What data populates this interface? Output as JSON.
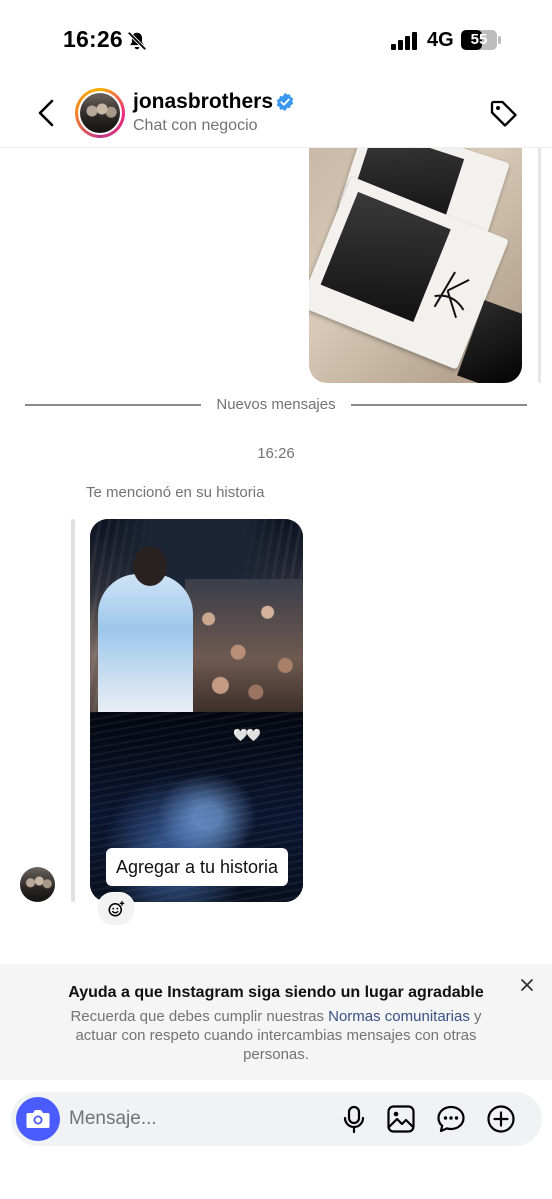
{
  "status_bar": {
    "time": "16:26",
    "network": "4G",
    "battery": "55"
  },
  "header": {
    "username": "jonasbrothers",
    "subtitle": "Chat con negocio",
    "verified": true
  },
  "conversation": {
    "divider_label": "Nuevos mensajes",
    "timestamp": "16:26",
    "mention_text": "Te mencionó en su historia",
    "story_button": "Agregar a tu historia",
    "story_hearts": "🤍🤍"
  },
  "notice": {
    "title": "Ayuda a que Instagram siga siendo un lugar agradable",
    "body_before": "Recuerda que debes cumplir nuestras ",
    "link": "Normas comunitarias",
    "body_after": " y actuar con respeto cuando intercambias mensajes con otras personas."
  },
  "composer": {
    "placeholder": "Mensaje..."
  },
  "colors": {
    "accent": "#4a5bff",
    "verified": "#3897f0",
    "link": "#385185",
    "muted_text": "#737373"
  },
  "icons": [
    "bell-slash-icon",
    "signal-icon",
    "battery-icon",
    "back-icon",
    "verified-icon",
    "tag-icon",
    "close-icon",
    "camera-icon",
    "microphone-icon",
    "gallery-icon",
    "sticker-icon",
    "add-icon",
    "emoji-react-icon"
  ]
}
